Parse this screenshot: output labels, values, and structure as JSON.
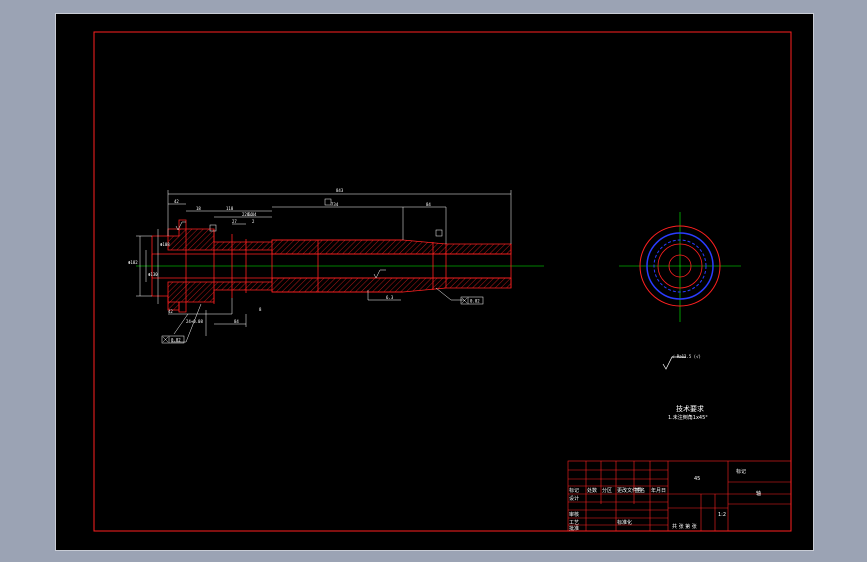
{
  "colors": {
    "outline": "#ff2020",
    "dimension": "#ffffff",
    "centerline": "#00ff00",
    "bore": "#2a3cff",
    "hatch": "#ff2020",
    "background": "#000000",
    "viewport": "#9ba3b4"
  },
  "dimensions": {
    "overall_length": "843",
    "segment_left": "42",
    "segment_small": "18",
    "segment_mid": "118",
    "segment_a": "56",
    "segment_mid2": "734",
    "segment_right": "84",
    "segment_b": "228.44",
    "height_small": "27",
    "bore_a": "2",
    "dia_left": "Φ182",
    "dia_mid": "Φ130",
    "dia_main": "Φ108",
    "bottom_left": "42",
    "bottom_mid": "24+0.08",
    "bottom_right": "84",
    "depth": "8"
  },
  "tolerances": {
    "left": "0.02",
    "right": "0.02",
    "bottom": "0.02"
  },
  "surface_finish": {
    "roughness_symbol": "√ Ra12.5 (√)",
    "note_small": "6.3"
  },
  "notes": {
    "title": "技术要求",
    "item1": "1.未注倒角1x45°"
  },
  "title_block": {
    "part_name": "轴",
    "scale": "1:2",
    "material": "45",
    "drawing_no": "标记",
    "sheet": "共 张 第 张",
    "headers": [
      "标记",
      "处数",
      "分区",
      "更改文件号",
      "签名",
      "年月日"
    ],
    "roles": [
      "设计",
      "审核",
      "工艺",
      "标准化",
      "批准"
    ]
  }
}
